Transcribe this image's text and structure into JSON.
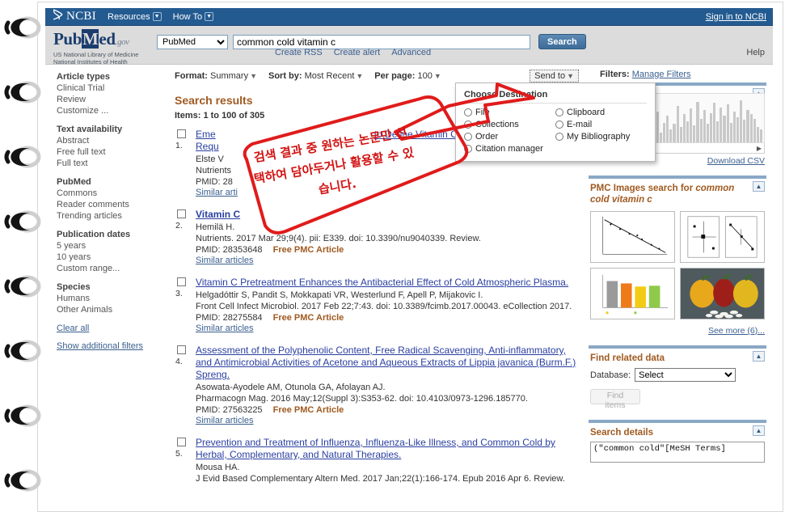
{
  "ncbi_bar": {
    "logo": "NCBI",
    "menus": [
      "Resources",
      "How To"
    ],
    "signin": "Sign in to NCBI"
  },
  "pubmed_header": {
    "logo_pub": "Pub",
    "logo_m": "M",
    "logo_ed": "ed",
    "logo_gov": ".gov",
    "subtitle_line1": "US National Library of Medicine",
    "subtitle_line2": "National Institutes of Health",
    "database": "PubMed",
    "database_options": [
      "PubMed"
    ],
    "query": "common cold vitamin c",
    "query_placeholder": "Search PubMed",
    "search_button": "Search",
    "links": [
      "Create RSS",
      "Create alert",
      "Advanced"
    ],
    "help": "Help"
  },
  "sidebar": {
    "groups": [
      {
        "head": "Article types",
        "items": [
          "Clinical Trial",
          "Review",
          "Customize ..."
        ]
      },
      {
        "head": "Text availability",
        "items": [
          "Abstract",
          "Free full text",
          "Full text"
        ]
      },
      {
        "head": "PubMed",
        "items": [
          "Commons",
          "Reader comments",
          "Trending articles"
        ]
      },
      {
        "head": "Publication dates",
        "items": [
          "5 years",
          "10 years",
          "Custom range..."
        ]
      },
      {
        "head": "Species",
        "items": [
          "Humans",
          "Other Animals"
        ]
      }
    ],
    "clear_all": "Clear all",
    "show_additional": "Show additional filters"
  },
  "toolbar": {
    "format_label": "Format:",
    "format_value": "Summary",
    "sort_label": "Sort by:",
    "sort_value": "Most Recent",
    "perpage_label": "Per page:",
    "perpage_value": "100",
    "send_to": "Send to",
    "filters_label": "Filters:",
    "manage_filters": "Manage Filters"
  },
  "send_to_panel": {
    "title": "Choose Destination",
    "options_left": [
      "File",
      "Collections",
      "Order",
      "Citation manager"
    ],
    "options_right": [
      "Clipboard",
      "E-mail",
      "My Bibliography"
    ]
  },
  "results_header": {
    "title": "Search results",
    "count": "Items: 1 to 100 of 305"
  },
  "results": [
    {
      "num": "1.",
      "title_prefix": "Eme",
      "title_line2_prefix": "Requ",
      "title_suffix": "to Define Vitamin C Intake",
      "authors": "Elste V",
      "source": "Nutrients",
      "pmid": "PMID: 28",
      "free": "",
      "similar": "Similar arti"
    },
    {
      "num": "2.",
      "title": "Vitamin C",
      "authors": "Hemilä H.",
      "source": "Nutrients. 2017 Mar 29;9(4). pii: E339. doi: 10.3390/nu9040339. Review.",
      "pmid": "PMID: 28353648",
      "free": "Free PMC Article",
      "similar": "Similar articles"
    },
    {
      "num": "3.",
      "title": "Vitamin C Pretreatment Enhances the Antibacterial Effect of Cold Atmospheric Plasma.",
      "authors": "Helgadóttir S, Pandit S, Mokkapati VR, Westerlund F, Apell P, Mijakovic I.",
      "source": "Front Cell Infect Microbiol. 2017 Feb 22;7:43. doi: 10.3389/fcimb.2017.00043. eCollection 2017.",
      "pmid": "PMID: 28275584",
      "free": "Free PMC Article",
      "similar": "Similar articles"
    },
    {
      "num": "4.",
      "title": "Assessment of the Polyphenolic Content, Free Radical Scavenging, Anti-inflammatory, and Antimicrobial Activities of Acetone and Aqueous Extracts of Lippia javanica (Burm.F.) Spreng.",
      "authors": "Asowata-Ayodele AM, Otunola GA, Afolayan AJ.",
      "source": "Pharmacogn Mag. 2016 May;12(Suppl 3):S353-62. doi: 10.4103/0973-1296.185770.",
      "pmid": "PMID: 27563225",
      "free": "Free PMC Article",
      "similar": "Similar articles"
    },
    {
      "num": "5.",
      "title": "Prevention and Treatment of Influenza, Influenza-Like Illness, and Common Cold by Herbal, Complementary, and Natural Therapies.",
      "authors": "Mousa HA.",
      "source": "J Evid Based Complementary Altern Med. 2017 Jan;22(1):166-174. Epub 2016 Apr 6. Review.",
      "pmid": "",
      "free": "",
      "similar": ""
    }
  ],
  "right_panels": {
    "results_by_year": {
      "download_csv": "Download CSV",
      "bars": [
        6,
        4,
        9,
        5,
        14,
        8,
        6,
        18,
        11,
        7,
        22,
        30,
        12,
        9,
        24,
        16,
        10,
        34,
        20,
        44,
        14,
        28,
        38,
        18,
        26,
        52,
        22,
        40,
        30,
        48,
        24,
        58,
        34,
        46,
        26,
        42,
        56,
        30,
        50,
        38,
        54,
        28,
        44,
        36,
        60,
        32,
        46,
        40,
        34,
        22,
        18
      ]
    },
    "pmc_images": {
      "head_prefix": "PMC Images search for ",
      "head_query": "common cold vitamin c",
      "see_more": "See more (6)..."
    },
    "find_related": {
      "head": "Find related data",
      "db_label": "Database:",
      "db_value": "Select",
      "db_options": [
        "Select"
      ],
      "find_button": "Find items"
    },
    "search_details": {
      "head": "Search details",
      "text": "(\"common cold\"[MeSH Terms]"
    }
  },
  "annotation": {
    "line1": "검색 결과 중 원하는 논문만 선",
    "line2": "택하여 담아두거나 활용할 수 있",
    "line3": "습니다."
  },
  "colors": {
    "ncbi_blue": "#235a90",
    "panel_blue": "#8aa8c6",
    "heading_orange": "#a05a20",
    "link_blue": "#2a3fa0",
    "annotation_red": "#d21414"
  }
}
